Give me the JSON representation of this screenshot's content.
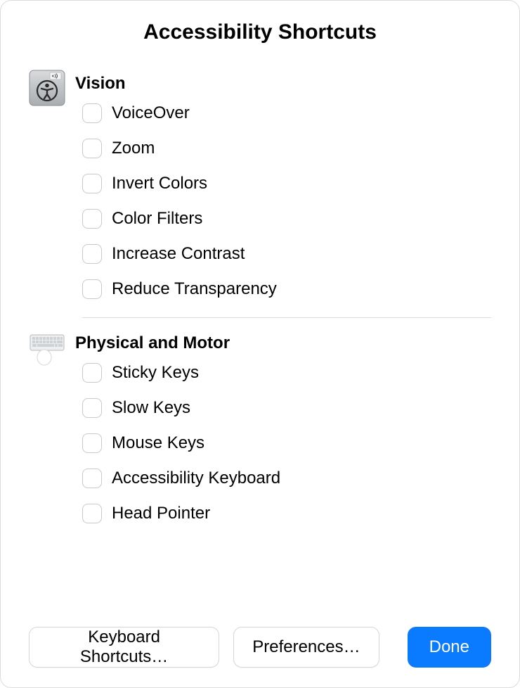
{
  "title": "Accessibility Shortcuts",
  "sections": {
    "vision": {
      "title": "Vision",
      "items": [
        {
          "label": "VoiceOver"
        },
        {
          "label": "Zoom"
        },
        {
          "label": "Invert Colors"
        },
        {
          "label": "Color Filters"
        },
        {
          "label": "Increase Contrast"
        },
        {
          "label": "Reduce Transparency"
        }
      ]
    },
    "physical": {
      "title": "Physical and Motor",
      "items": [
        {
          "label": "Sticky Keys"
        },
        {
          "label": "Slow Keys"
        },
        {
          "label": "Mouse Keys"
        },
        {
          "label": "Accessibility Keyboard"
        },
        {
          "label": "Head Pointer"
        }
      ]
    }
  },
  "footer": {
    "keyboard_shortcuts_label": "Keyboard Shortcuts…",
    "preferences_label": "Preferences…",
    "done_label": "Done"
  }
}
